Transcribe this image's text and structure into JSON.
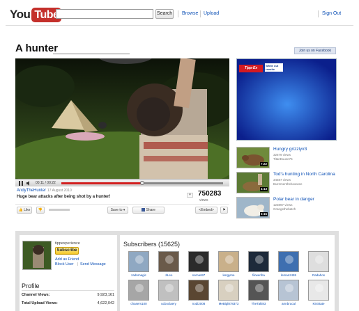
{
  "header": {
    "logo_you": "You",
    "logo_tube": "Tube",
    "search_button": "Search",
    "browse": "Browse",
    "upload": "Upload",
    "sign_out": "Sign Out"
  },
  "video": {
    "title": "A hunter",
    "join_facebook": "Join us on Facebook",
    "time": "00:11 / 00:22",
    "progress_fraction": 0.5,
    "uploader": "AndyTheHunter",
    "date": "17 August 2010",
    "description": "Huge bear attacks after being shot by a hunter!",
    "view_count": "750283",
    "views_label": "views"
  },
  "actions": {
    "like": "Like",
    "save_to": "Save to",
    "share": "Share",
    "embed": "<Embed>"
  },
  "ad": {
    "brand": "Tipp-Ex",
    "tagline": "White out rewrite"
  },
  "related": [
    {
      "title": "Hungry grizzly#3",
      "views": "32679 views",
      "channel": "TitanEuuse75",
      "duration": "7:22"
    },
    {
      "title": "Tod's hunting in North Carolina",
      "views": "34587 views",
      "channel": "Buzzmenthebowwee",
      "duration": "4:13"
    },
    {
      "title": "Polar bear in danger",
      "views": "123897 views",
      "channel": "Grangethebatch",
      "duration": "5:15"
    }
  ],
  "channel": {
    "name": "tippexperience",
    "subscribe": "Subscribe",
    "add_friend": "Add as Friend",
    "block_user": "Block User",
    "send_message": "Send Message",
    "profile_heading": "Profile",
    "channel_views_label": "Channel Views:",
    "channel_views_value": "9,923,161",
    "upload_views_label": "Total Upload Views:",
    "upload_views_value": "4,622,042"
  },
  "subscribers": {
    "heading": "Subscribers (15625)",
    "row1": [
      "zadnmagic",
      "JiLeo",
      "sornas97",
      "lengyme",
      "fikweriha",
      "lemanz455",
      "Radahos"
    ],
    "row2": [
      "chasers100",
      "ucboclaery",
      "nodi2008",
      "MeBigl878373",
      "TheTaki83",
      "amrbrucal",
      "KinState"
    ]
  },
  "colors": {
    "accent_link": "#0b4fb5",
    "brand_red": "#c4302b",
    "subscribe_yellow": "#f3c623",
    "progress_red": "#d21e1e"
  }
}
